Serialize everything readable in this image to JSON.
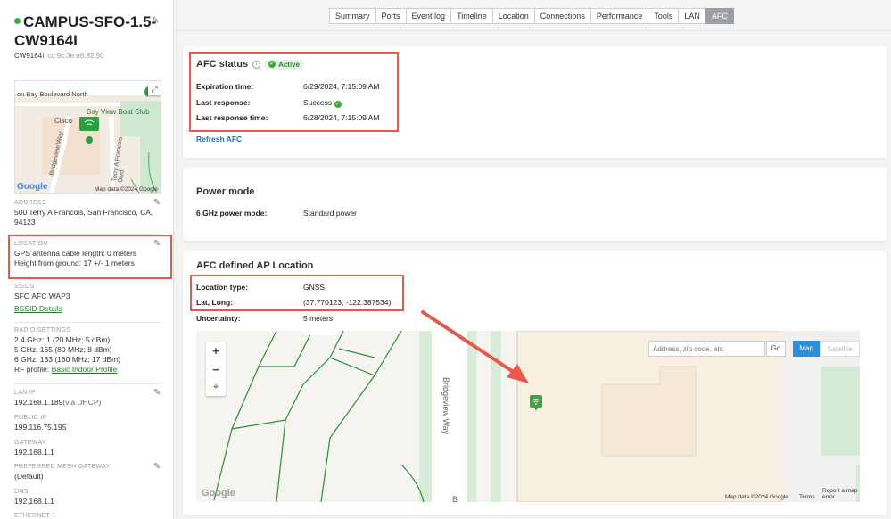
{
  "device": {
    "name": "CAMPUS-SFO-1.5-CW9164I",
    "model": "CW9164I",
    "mac": "cc:9c:3e:e8:82:90",
    "status_color": "#47a447"
  },
  "mini_map": {
    "labels": [
      "on Bay Boulevard North",
      "Bay View Boat Club",
      "Cisco",
      "Bridgeview Way",
      "Terry A Francois Blvd"
    ],
    "logo": "Google",
    "attribution": "Map data ©2024 Google"
  },
  "sidebar": {
    "address": {
      "label": "ADDRESS",
      "value": "500 Terry A Francois, San Francisco, CA, 94123"
    },
    "location": {
      "label": "LOCATION",
      "line1": "GPS antenna cable length: 0 meters",
      "line2": "Height from ground: 17 +/- 1 meters"
    },
    "ssids": {
      "label": "SSIDS",
      "value": "SFO AFC WAP3",
      "link": "BSSID Details"
    },
    "radio": {
      "label": "RADIO SETTINGS",
      "line1": "2.4 GHz: 1 (20 MHz; 5 dBm)",
      "line2": "5 GHz: 165 (80 MHz; 8 dBm)",
      "line3": "6 GHz: 133 (160 MHz; 17 dBm)",
      "rf_prefix": "RF profile:",
      "rf_link": "Basic Indoor Profile"
    },
    "lan_ip": {
      "label": "LAN IP",
      "value": "192.168.1.189",
      "suffix": "(via DHCP)"
    },
    "public_ip": {
      "label": "PUBLIC IP",
      "value": "199.116.75.195"
    },
    "gateway": {
      "label": "GATEWAY",
      "value": "192.168.1.1"
    },
    "mesh": {
      "label": "PREFERRED MESH GATEWAY",
      "value": "(Default)"
    },
    "dns": {
      "label": "DNS",
      "value": "192.168.1.1"
    },
    "ethernet": {
      "label": "ETHERNET 1"
    }
  },
  "tabs": [
    "Summary",
    "Ports",
    "Event log",
    "Timeline",
    "Location",
    "Connections",
    "Performance",
    "Tools",
    "LAN",
    "AFC"
  ],
  "active_tab": "AFC",
  "afc_status": {
    "title": "AFC status",
    "badge": "Active",
    "expiration_label": "Expiration time:",
    "expiration_value": "6/29/2024, 7:15:09 AM",
    "last_response_label": "Last response:",
    "last_response_value": "Success",
    "last_response_time_label": "Last response time:",
    "last_response_time_value": "6/28/2024, 7:15:09 AM",
    "refresh_link": "Refresh AFC"
  },
  "power_mode": {
    "title": "Power mode",
    "label": "6 GHz power mode:",
    "value": "Standard power"
  },
  "afc_location": {
    "title": "AFC defined AP Location",
    "type_label": "Location type:",
    "type_value": "GNSS",
    "latlong_label": "Lat, Long:",
    "latlong_value": "(37.770123, -122.387534)",
    "uncertainty_label": "Uncertainty:",
    "uncertainty_value": "5 meters"
  },
  "big_map": {
    "search_placeholder": "Address, zip code, etc.",
    "go": "Go",
    "map_btn": "Map",
    "satellite_btn": "Satellite",
    "street_label": "Bridgeview Way",
    "street_label_2": "B",
    "logo": "Google",
    "attribution": "Map data ©2024 Google",
    "terms": "Terms",
    "report": "Report a map error"
  },
  "colors": {
    "highlight": "#e35a4e",
    "accent_blue": "#2a8fd8",
    "success_green": "#3aa83a",
    "link_blue": "#2a6fb8"
  }
}
